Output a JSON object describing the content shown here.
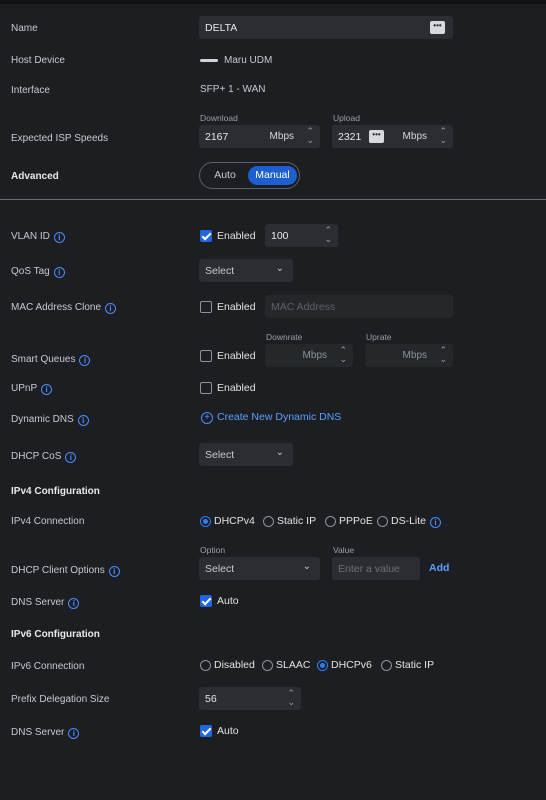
{
  "name": {
    "label": "Name",
    "value": "DELTA",
    "menu_icon": "more-dots-icon"
  },
  "host_device": {
    "label": "Host Device",
    "value": "Maru UDM"
  },
  "interface": {
    "label": "Interface",
    "value": "SFP+ 1 - WAN"
  },
  "isp_speeds": {
    "label": "Expected ISP Speeds",
    "download_label": "Download",
    "download_value": "2167",
    "download_unit": "Mbps",
    "upload_label": "Upload",
    "upload_value": "2321",
    "upload_unit": "Mbps"
  },
  "advanced": {
    "label": "Advanced",
    "options": [
      "Auto",
      "Manual"
    ],
    "selected": "Manual"
  },
  "vlan": {
    "label": "VLAN ID",
    "enabled_label": "Enabled",
    "enabled": true,
    "value": "100"
  },
  "qos": {
    "label": "QoS Tag",
    "select": "Select"
  },
  "mac_clone": {
    "label": "MAC Address Clone",
    "enabled_label": "Enabled",
    "enabled": false,
    "placeholder": "MAC Address"
  },
  "smart_queues": {
    "label": "Smart Queues",
    "enabled_label": "Enabled",
    "enabled": false,
    "downrate_label": "Downrate",
    "downrate_unit": "Mbps",
    "uprate_label": "Uprate",
    "uprate_unit": "Mbps"
  },
  "upnp": {
    "label": "UPnP",
    "enabled_label": "Enabled",
    "enabled": false
  },
  "ddns": {
    "label": "Dynamic DNS",
    "link": "Create New Dynamic DNS"
  },
  "dhcp_cos": {
    "label": "DHCP CoS",
    "select": "Select"
  },
  "ipv4_config": {
    "heading": "IPv4 Configuration"
  },
  "ipv4_conn": {
    "label": "IPv4 Connection",
    "options": [
      "DHCPv4",
      "Static IP",
      "PPPoE",
      "DS-Lite"
    ],
    "selected": "DHCPv4"
  },
  "dhcp_client": {
    "label": "DHCP Client Options",
    "option_label": "Option",
    "value_label": "Value",
    "select": "Select",
    "value_placeholder": "Enter a value",
    "add": "Add"
  },
  "dns4": {
    "label": "DNS Server",
    "auto_label": "Auto",
    "auto": true
  },
  "ipv6_config": {
    "heading": "IPv6 Configuration"
  },
  "ipv6_conn": {
    "label": "IPv6 Connection",
    "options": [
      "Disabled",
      "SLAAC",
      "DHCPv6",
      "Static IP"
    ],
    "selected": "DHCPv6"
  },
  "prefix": {
    "label": "Prefix Delegation Size",
    "value": "56"
  },
  "dns6": {
    "label": "DNS Server",
    "auto_label": "Auto",
    "auto": true
  },
  "colors": {
    "background": "#1c1e21",
    "field": "#2a2d31",
    "accent": "#2066e0",
    "link": "#5aa0ff"
  }
}
